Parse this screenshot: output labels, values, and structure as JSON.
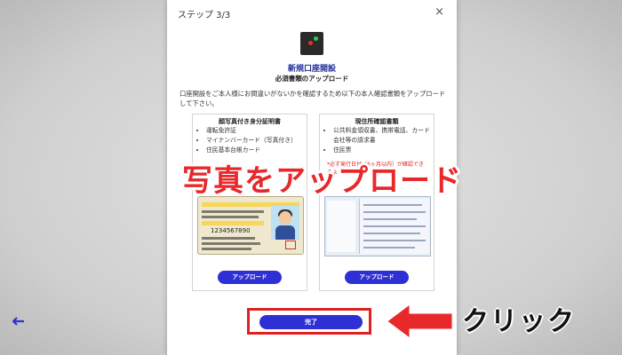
{
  "dialog": {
    "step": "ステップ 3/3",
    "close": "×",
    "title": "新規口座開設",
    "subtitle": "必須書類のアップロード",
    "description": "口座開設をご本人様にお間違いがないかを確認するため以下の本人確認書類をアップロードして下さい。"
  },
  "cards": [
    {
      "heading": "顔写真付き身分証明書",
      "items": [
        "運転免許証",
        "マイナンバーカード（写真付き）",
        "住民基本台帳カード"
      ],
      "upload_label": "アップロード",
      "illustration_number": "1234567890"
    },
    {
      "heading": "現住所確認書類",
      "items": [
        "公共料金領収書、携帯電話、カード会社等の請求書",
        "住民票"
      ],
      "note": "*必ず発行日付（6ヶ月以内）が確認できるように下さい。",
      "upload_label": "アップロード"
    }
  ],
  "overlay_label": "写真をアップロード",
  "footer": {
    "back_icon": "arrow-left-icon",
    "done_label": "完了"
  },
  "annotation": {
    "click_label": "クリック"
  },
  "colors": {
    "accent": "#2f2fd6",
    "highlight": "#e02020",
    "title": "#1f2b99"
  }
}
